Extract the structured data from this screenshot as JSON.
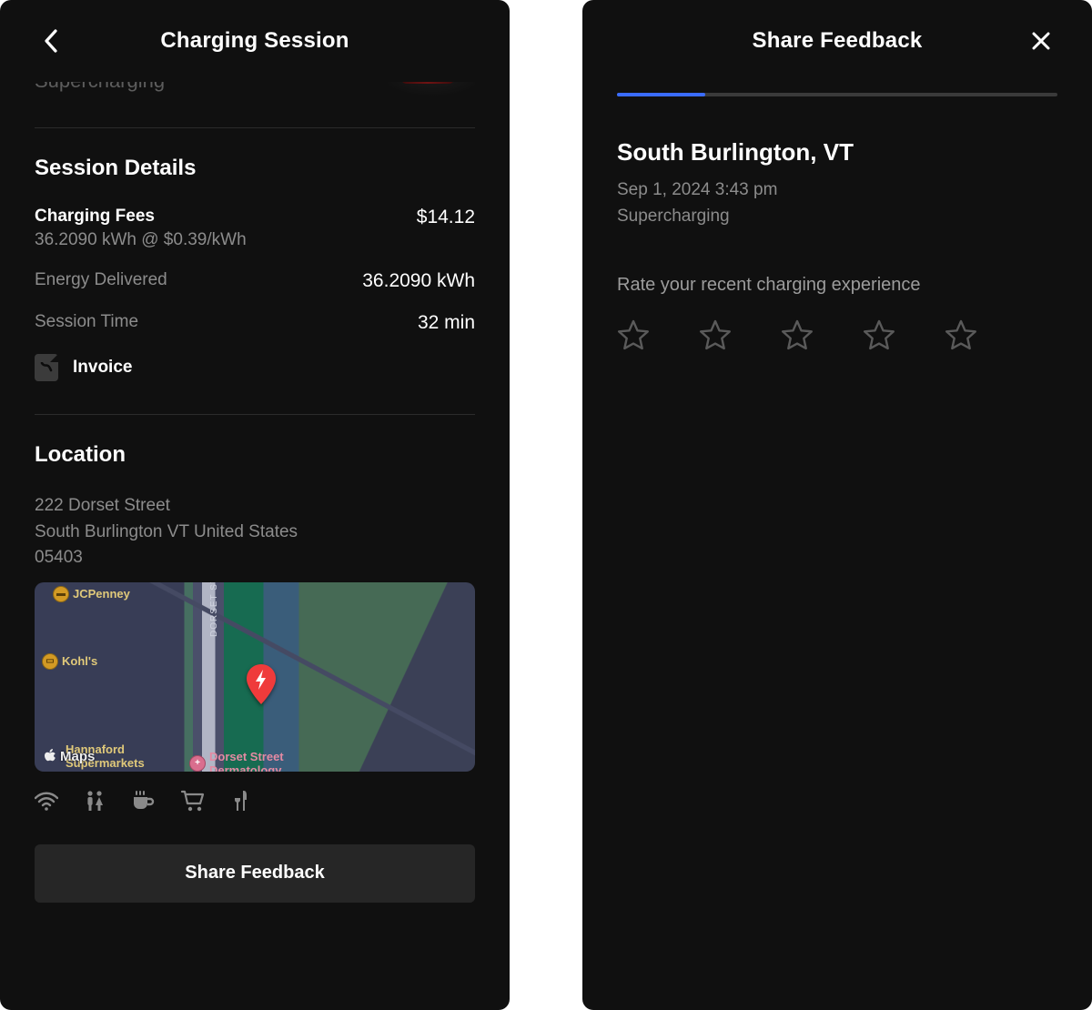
{
  "left": {
    "title": "Charging Session",
    "cutoff_label": "Supercharging",
    "session": {
      "heading": "Session Details",
      "fees_label": "Charging Fees",
      "fees_sub": "36.2090 kWh @ $0.39/kWh",
      "fees_value": "$14.12",
      "energy_label": "Energy Delivered",
      "energy_value": "36.2090 kWh",
      "time_label": "Session Time",
      "time_value": "32 min",
      "invoice_label": "Invoice"
    },
    "location": {
      "heading": "Location",
      "line1": "222 Dorset Street",
      "line2": "South Burlington VT United States",
      "line3": "05403",
      "map": {
        "provider_label": "Maps",
        "street_label": "DORSET ST",
        "poi_jcpenney": "JCPenney",
        "poi_kohls": "Kohl's",
        "poi_hannaford_top": "Hannaford",
        "poi_hannaford_bot": "Supermarkets",
        "poi_derm_top": "Dorset Street",
        "poi_derm_bot": "Dermatology"
      }
    },
    "amenities": [
      "wifi",
      "restrooms",
      "coffee",
      "shopping",
      "food"
    ],
    "share_button": "Share Feedback"
  },
  "right": {
    "title": "Share Feedback",
    "progress_percent": 20,
    "location": "South Burlington, VT",
    "timestamp": "Sep 1, 2024 3:43 pm",
    "type": "Supercharging",
    "rate_prompt": "Rate your recent charging experience",
    "star_count": 5
  },
  "colors": {
    "accent": "#3a6cff",
    "pin": "#ef3b3b"
  }
}
